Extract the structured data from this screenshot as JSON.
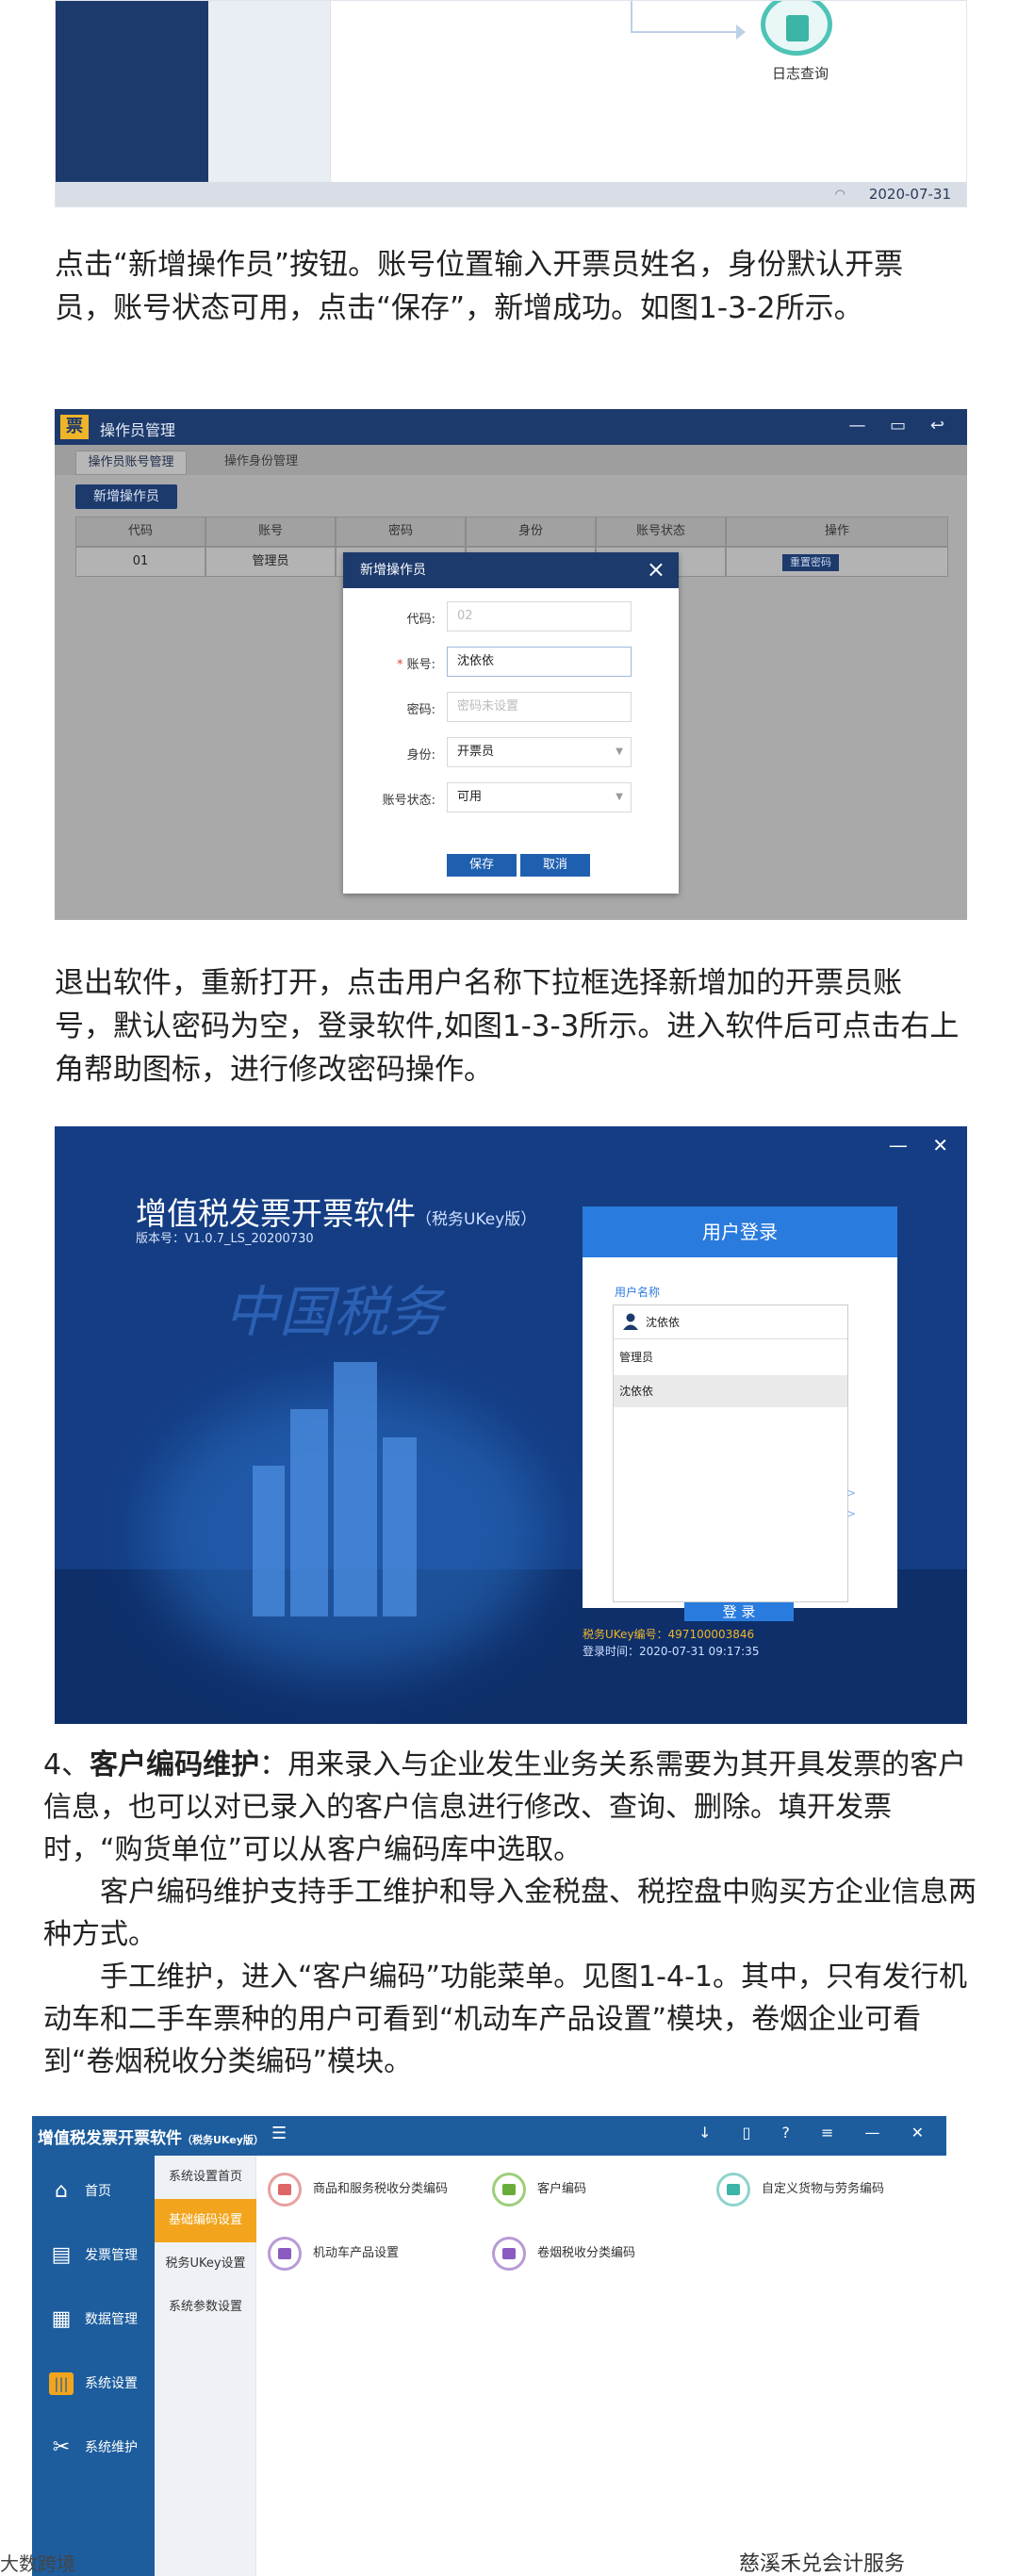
{
  "figure1": {
    "log_label": "日志查询",
    "date": "2020-07-31"
  },
  "para1": "点击“新增操作员”按钮。账号位置输入开票员姓名，身份默认开票员，账号状态可用，点击“保存”，新增成功。如图1-3-2所示。",
  "figure2": {
    "window_title": "操作员管理",
    "logo": "票",
    "tabs": [
      "操作员账号管理",
      "操作身份管理"
    ],
    "add_button": "新增操作员",
    "columns": [
      "代码",
      "账号",
      "密码",
      "身份",
      "账号状态",
      "操作"
    ],
    "row": {
      "code": "01",
      "account": "管理员",
      "action": "重置密码"
    },
    "dialog": {
      "title": "新增操作员",
      "fields": [
        {
          "label": "代码:",
          "value": "02",
          "placeholder": true
        },
        {
          "label": "账号:",
          "value": "沈依依",
          "required": true
        },
        {
          "label": "密码:",
          "value": "密码未设置",
          "placeholder": true
        },
        {
          "label": "身份:",
          "value": "开票员",
          "select": true
        },
        {
          "label": "账号状态:",
          "value": "可用",
          "select": true
        }
      ],
      "save": "保存",
      "cancel": "取消"
    }
  },
  "para2": "退出软件，重新打开，点击用户名称下拉框选择新增加的开票员账号，默认密码为空，登录软件,如图1-3-3所示。进入软件后可点击右上角帮助图标，进行修改密码操作。",
  "figure3": {
    "app_title": "增值税发票开票软件",
    "app_edition": "（税务UKey版）",
    "version": "版本号：V1.0.7_LS_20200730",
    "calligraphy": "中国税务",
    "login_title": "用户登录",
    "user_label": "用户名称",
    "selected_user": "沈依依",
    "options": [
      "管理员",
      "沈依依"
    ],
    "login_button": "登 录",
    "ukey": "税务UKey编号：497100003846",
    "login_time": "登录时间：2020-07-31 09:17:35"
  },
  "para3": {
    "lead": "4、",
    "bold": "客户编码维护",
    "rest": "：用来录入与企业发生业务关系需要为其开具发票的客户信息，也可以对已录入的客户信息进行修改、查询、删除。填开发票时，“购货单位”可以从客户编码库中选取。"
  },
  "para4": "客户编码维护支持手工维护和导入金税盘、税控盘中购买方企业信息两种方式。",
  "para5": "手工维护，进入“客户编码”功能菜单。见图1-4-1。其中，只有发行机动车和二手车票种的用户可看到“机动车产品设置”模块，卷烟企业可看到“卷烟税收分类编码”模块。",
  "figure4": {
    "app_title": "增值税发票开票软件",
    "app_edition": "（税务UKey版）",
    "nav": [
      "首页",
      "发票管理",
      "数据管理",
      "系统设置",
      "系统维护"
    ],
    "sub": [
      "系统设置首页",
      "基础编码设置",
      "税务UKey设置",
      "系统参数设置"
    ],
    "features": [
      "商品和服务税收分类编码",
      "客户编码",
      "自定义货物与劳务编码",
      "机动车产品设置",
      "卷烟税收分类编码"
    ]
  },
  "watermark": "慈溪禾兑会计服务",
  "watermark2": "大数跨境",
  "colors": {
    "navy": "#1d3a6d",
    "blue": "#1d5d9e",
    "orange": "#f2a51c"
  }
}
